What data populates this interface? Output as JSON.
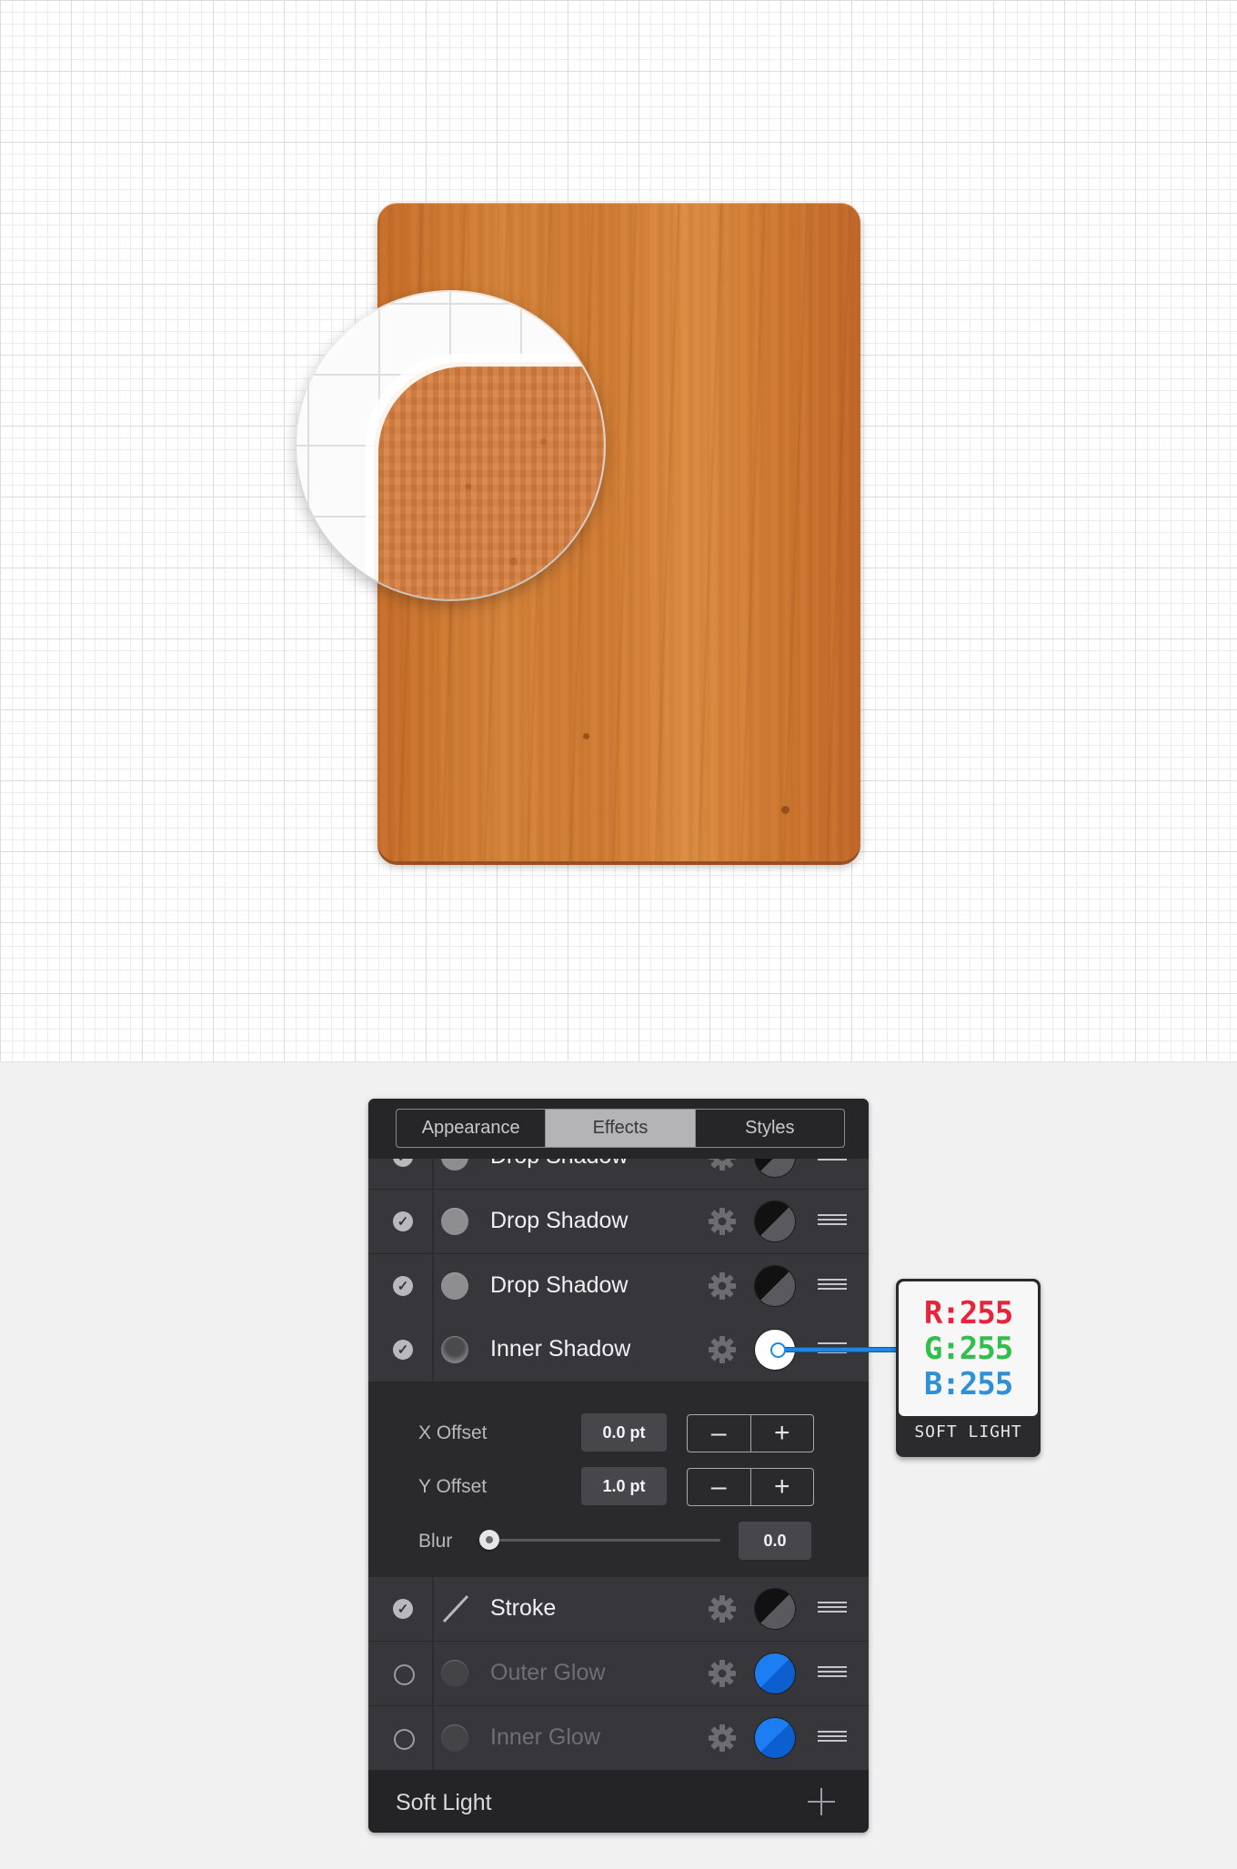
{
  "tabs": [
    {
      "label": "Appearance",
      "active": false
    },
    {
      "label": "Effects",
      "active": true
    },
    {
      "label": "Styles",
      "active": false
    }
  ],
  "effects": [
    {
      "label": "Drop Shadow",
      "enabled": true,
      "color": "black-split"
    },
    {
      "label": "Drop Shadow",
      "enabled": true,
      "color": "black-split"
    },
    {
      "label": "Drop Shadow",
      "enabled": true,
      "color": "black-split"
    },
    {
      "label": "Inner Shadow",
      "enabled": true,
      "color": "#ffffff",
      "expanded": true
    },
    {
      "label": "Stroke",
      "enabled": true,
      "color": "black-split"
    },
    {
      "label": "Outer Glow",
      "enabled": false,
      "color": "#1d7ef3"
    },
    {
      "label": "Inner Glow",
      "enabled": false,
      "color": "#1d7ef3"
    }
  ],
  "settings": {
    "x_offset_label": "X Offset",
    "x_offset_value": "0.0 pt",
    "y_offset_label": "Y Offset",
    "y_offset_value": "1.0 pt",
    "blur_label": "Blur",
    "blur_value": "0.0",
    "minus": "–",
    "plus": "+"
  },
  "footer": {
    "blend_mode": "Soft Light"
  },
  "callout": {
    "r": "R:255",
    "g": "G:255",
    "b": "B:255",
    "mode": "SOFT LIGHT"
  },
  "icons": {
    "check": "check-icon",
    "gear": "gear-icon",
    "drag": "drag-handle-icon",
    "add": "plus-icon",
    "stroke": "stroke-slash-icon"
  },
  "colors": {
    "wood": "#d4833a",
    "panel": "#2c2c30",
    "accent": "#1d86e6"
  }
}
